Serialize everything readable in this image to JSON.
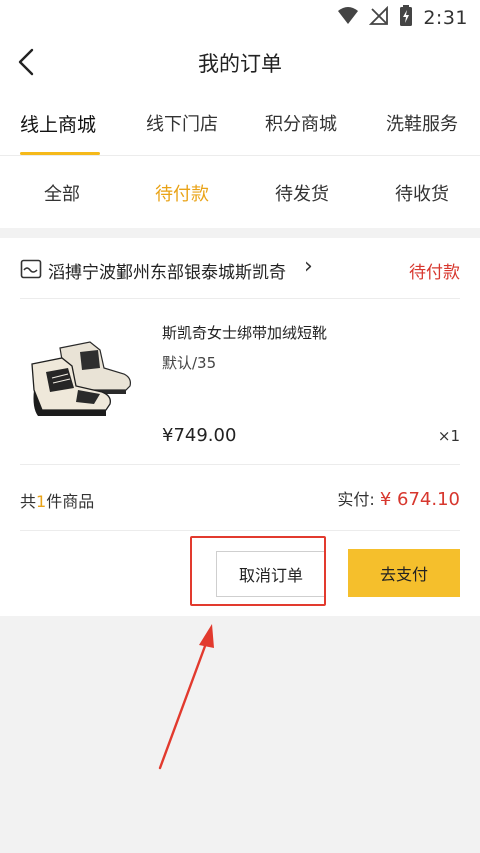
{
  "status_bar": {
    "time": "2:31",
    "icons": [
      "wifi-icon",
      "signal-off-icon",
      "battery-charging-icon"
    ]
  },
  "header": {
    "title": "我的订单",
    "back_icon": "chevron-left-icon"
  },
  "channel_tabs": [
    {
      "label": "线上商城",
      "active": true
    },
    {
      "label": "线下门店",
      "active": false
    },
    {
      "label": "积分商城",
      "active": false
    },
    {
      "label": "洗鞋服务",
      "active": false
    }
  ],
  "status_tabs": [
    {
      "label": "全部",
      "active": false
    },
    {
      "label": "待付款",
      "active": true
    },
    {
      "label": "待发货",
      "active": false
    },
    {
      "label": "待收货",
      "active": false
    }
  ],
  "order": {
    "store_icon": "store-icon",
    "store_name": "滔搏宁波鄞州东部银泰城斯凯奇",
    "status": "待付款",
    "product": {
      "name": "斯凯奇女士绑带加绒短靴",
      "spec": "默认/35",
      "price": "¥749.00",
      "quantity": "×1",
      "image_icon": "shoe-image"
    },
    "summary": {
      "count_prefix": "共",
      "count": "1",
      "count_suffix": "件商品",
      "paid_label": "实付:",
      "paid_amount": "¥ 674.10"
    },
    "buttons": {
      "cancel": "取消订单",
      "pay": "去支付"
    }
  },
  "colors": {
    "accent": "#f5b91a",
    "active_tab_text": "#e9a318",
    "status_red": "#d7372e",
    "pay_button": "#f5bf2c",
    "annotation_red": "#e23a2e"
  }
}
